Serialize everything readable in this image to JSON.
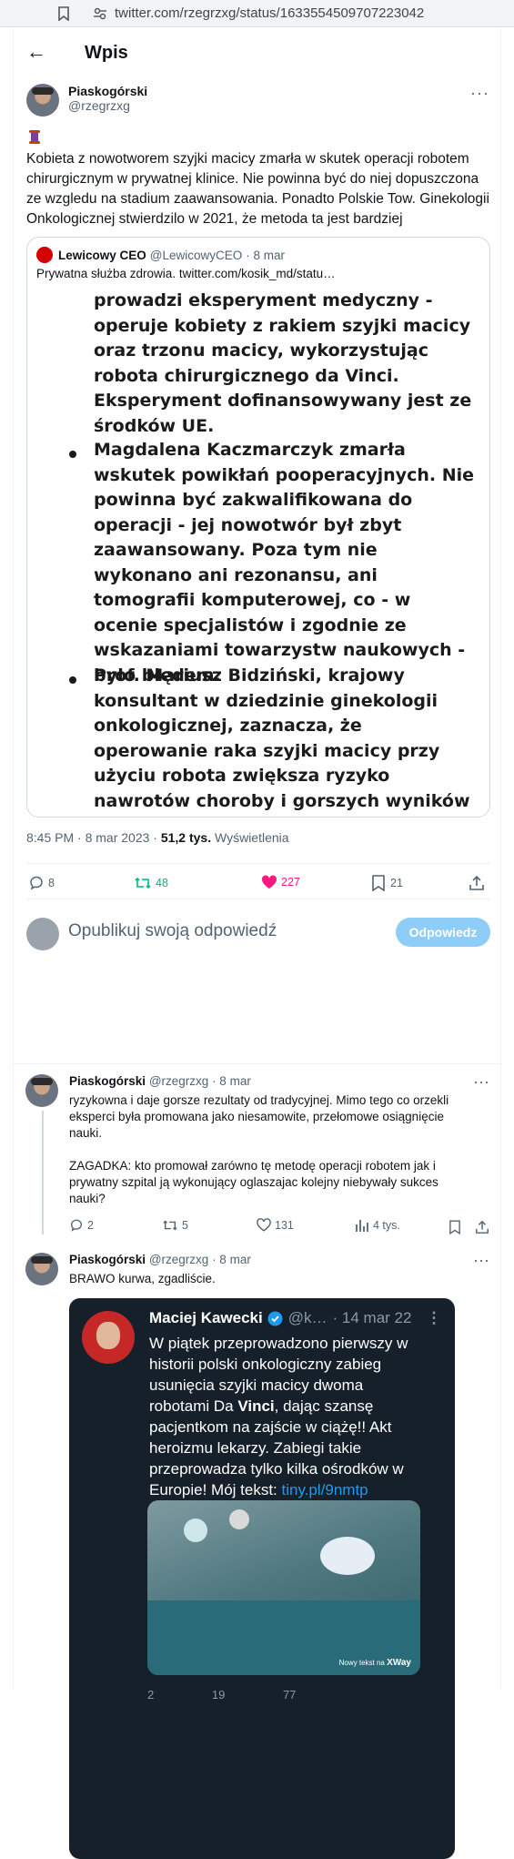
{
  "browser": {
    "url": "twitter.com/rzegrzxg/status/1633554509707223042"
  },
  "header": {
    "back_label": "←",
    "title": "Wpis"
  },
  "tweet": {
    "author_name": "Piaskogórski",
    "author_handle": "@rzegrzxg",
    "text": "Kobieta z nowotworem szyjki macicy zmarła w skutek operacji robotem chirurgicznym w prywatnej klinice. Nie powinna być do niej dopuszczona ze wzgledu na stadium zaawansowania. Ponadto Polskie Tow. Ginekologii Onkologicznej stwierdzilo w 2021, że metoda ta jest bardziej",
    "quote": {
      "name": "Lewicowy CEO",
      "handle": "@LewicowyCEO",
      "date": "· 8 mar",
      "text": "Prywatna służba zdrowia.  twitter.com/kosik_md/statu…",
      "image_paragraphs": [
        "prowadzi eksperyment medyczny - operuje kobiety z rakiem szyjki macicy oraz trzonu macicy, wykorzystując robota chirurgicznego da Vinci. Eksperyment dofinansowywany jest ze środków UE.",
        "Magdalena Kaczmarczyk zmarła wskutek powikłań pooperacyjnych. Nie powinna być zakwalifikowana do operacji - jej nowotwór był zbyt zaawansowany. Poza tym nie wykonano ani rezonansu, ani tomografii komputerowej, co - w ocenie specjalistów i zgodnie ze wskazaniami towarzystw naukowych - było błędem.",
        "Prof. Mariusz Bidziński, krajowy konsultant w dziedzinie ginekologii onkologicznej, zaznacza, że operowanie raka szyjki macicy przy użyciu robota zwiększa ryzyko nawrotów choroby i gorszych wyników leczenia niż przy standardowej metodzie. Podobnie stwierdziło w marcu 2021 r. Polskie Towarzystwo Ginekologii Onkologicznej – w tym czasie wiceprezesem instytucji był prof. Kazimierz Pityński, który…"
      ]
    },
    "time": "8:45 PM · 8 mar 2023 · ",
    "views_count": "51,2 tys.",
    "views_label": "Wyświetlenia",
    "stats": {
      "replies": "8",
      "retweets": "48",
      "likes": "227",
      "bookmarks": "21"
    },
    "colors": {
      "retweet": "#00ba7c",
      "like": "#f91880",
      "accent": "#1d9bf0"
    }
  },
  "compose": {
    "placeholder": "Opublikuj swoją odpowiedź",
    "button": "Odpowiedz"
  },
  "replies": [
    {
      "author_name": "Piaskogórski",
      "author_handle": "@rzegrzxg",
      "date": "· 8 mar",
      "text": "ryzykowna i daje gorsze rezultaty od tradycyjnej. Mimo tego co orzekli eksperci była promowana jako niesamowite, przełomowe osiągnięcie nauki.",
      "text2": "ZAGADKA: kto promował zarówno tę metodę operacji robotem jak i prywatny szpital ją wykonujący oglaszajac kolejny niebywały sukces nauki?",
      "stats": {
        "replies": "2",
        "retweets": "5",
        "likes": "131",
        "views": "4 tys."
      }
    },
    {
      "author_name": "Piaskogórski",
      "author_handle": "@rzegrzxg",
      "date": "· 8 mar",
      "text": "BRAWO kurwa, zgadliście.",
      "embed": {
        "name": "Maciej Kawecki",
        "handle": "@k…",
        "date": "· 14 mar 22",
        "text_before": "W piątek przeprowadzono pierwszy w historii polski onkologiczny zabieg usunięcia szyjki macicy dwoma robotami Da ",
        "text_bold": "Vinci",
        "text_after": ", dając szansę pacjentkom na zajście w ciążę!! Akt heroizmu lekarzy. Zabiegi takie przeprowadza tylko kilka ośrodków w Europie! Mój tekst: ",
        "link": "tiny.pl/9nmtp",
        "photo_caption": "Nowy tekst na",
        "photo_brand": "XWay",
        "stats": {
          "replies": "2",
          "retweets": "19",
          "likes": "77"
        }
      }
    }
  ]
}
